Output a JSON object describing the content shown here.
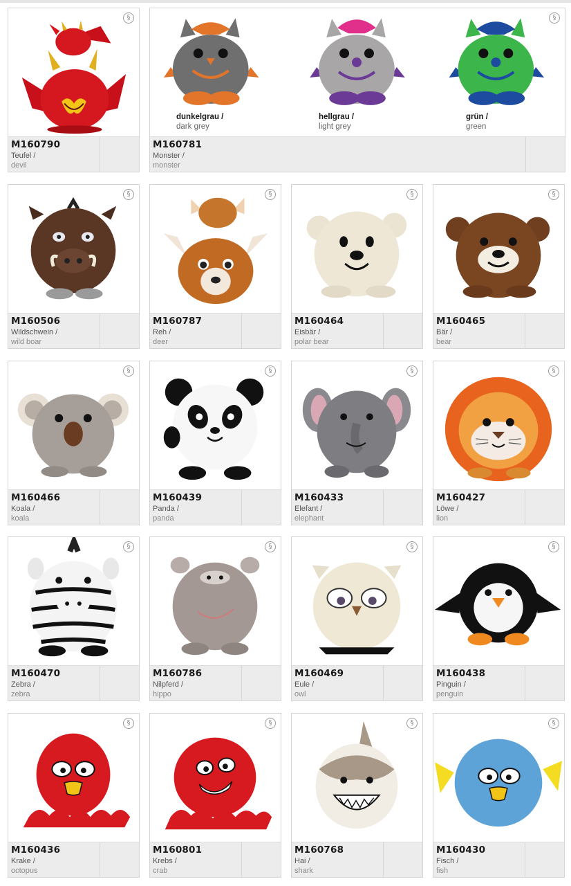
{
  "symbol": "§",
  "products": [
    {
      "code": "M160790",
      "de": "Teufel /",
      "en": "devil",
      "icon": "devil-plush"
    },
    {
      "code": "M160781",
      "de": "Monster /",
      "en": "monster",
      "icon": "monster-plush",
      "variants": [
        {
          "de": "dunkelgrau /",
          "en": "dark grey",
          "color": "#6f6f70"
        },
        {
          "de": "hellgrau /",
          "en": "light grey",
          "color": "#a9a6a8"
        },
        {
          "de": "grün /",
          "en": "green",
          "color": "#3cb54a"
        }
      ]
    },
    {
      "code": "M160506",
      "de": "Wildschwein /",
      "en": "wild boar",
      "icon": "wild-boar-plush"
    },
    {
      "code": "M160787",
      "de": "Reh /",
      "en": "deer",
      "icon": "deer-plush"
    },
    {
      "code": "M160464",
      "de": "Eisbär /",
      "en": "polar bear",
      "icon": "polar-bear-plush"
    },
    {
      "code": "M160465",
      "de": "Bär /",
      "en": "bear",
      "icon": "bear-plush"
    },
    {
      "code": "M160466",
      "de": "Koala /",
      "en": "koala",
      "icon": "koala-plush"
    },
    {
      "code": "M160439",
      "de": "Panda /",
      "en": "panda",
      "icon": "panda-plush"
    },
    {
      "code": "M160433",
      "de": "Elefant /",
      "en": "elephant",
      "icon": "elephant-plush"
    },
    {
      "code": "M160427",
      "de": "Löwe /",
      "en": "lion",
      "icon": "lion-plush"
    },
    {
      "code": "M160470",
      "de": "Zebra /",
      "en": "zebra",
      "icon": "zebra-plush"
    },
    {
      "code": "M160786",
      "de": "Nilpferd /",
      "en": "hippo",
      "icon": "hippo-plush"
    },
    {
      "code": "M160469",
      "de": "Eule /",
      "en": "owl",
      "icon": "owl-plush"
    },
    {
      "code": "M160438",
      "de": "Pinguin /",
      "en": "penguin",
      "icon": "penguin-plush"
    },
    {
      "code": "M160436",
      "de": "Krake /",
      "en": "octopus",
      "icon": "octopus-plush"
    },
    {
      "code": "M160801",
      "de": "Krebs /",
      "en": "crab",
      "icon": "crab-plush"
    },
    {
      "code": "M160768",
      "de": "Hai /",
      "en": "shark",
      "icon": "shark-plush"
    },
    {
      "code": "M160430",
      "de": "Fisch /",
      "en": "fish",
      "icon": "fish-plush"
    }
  ]
}
